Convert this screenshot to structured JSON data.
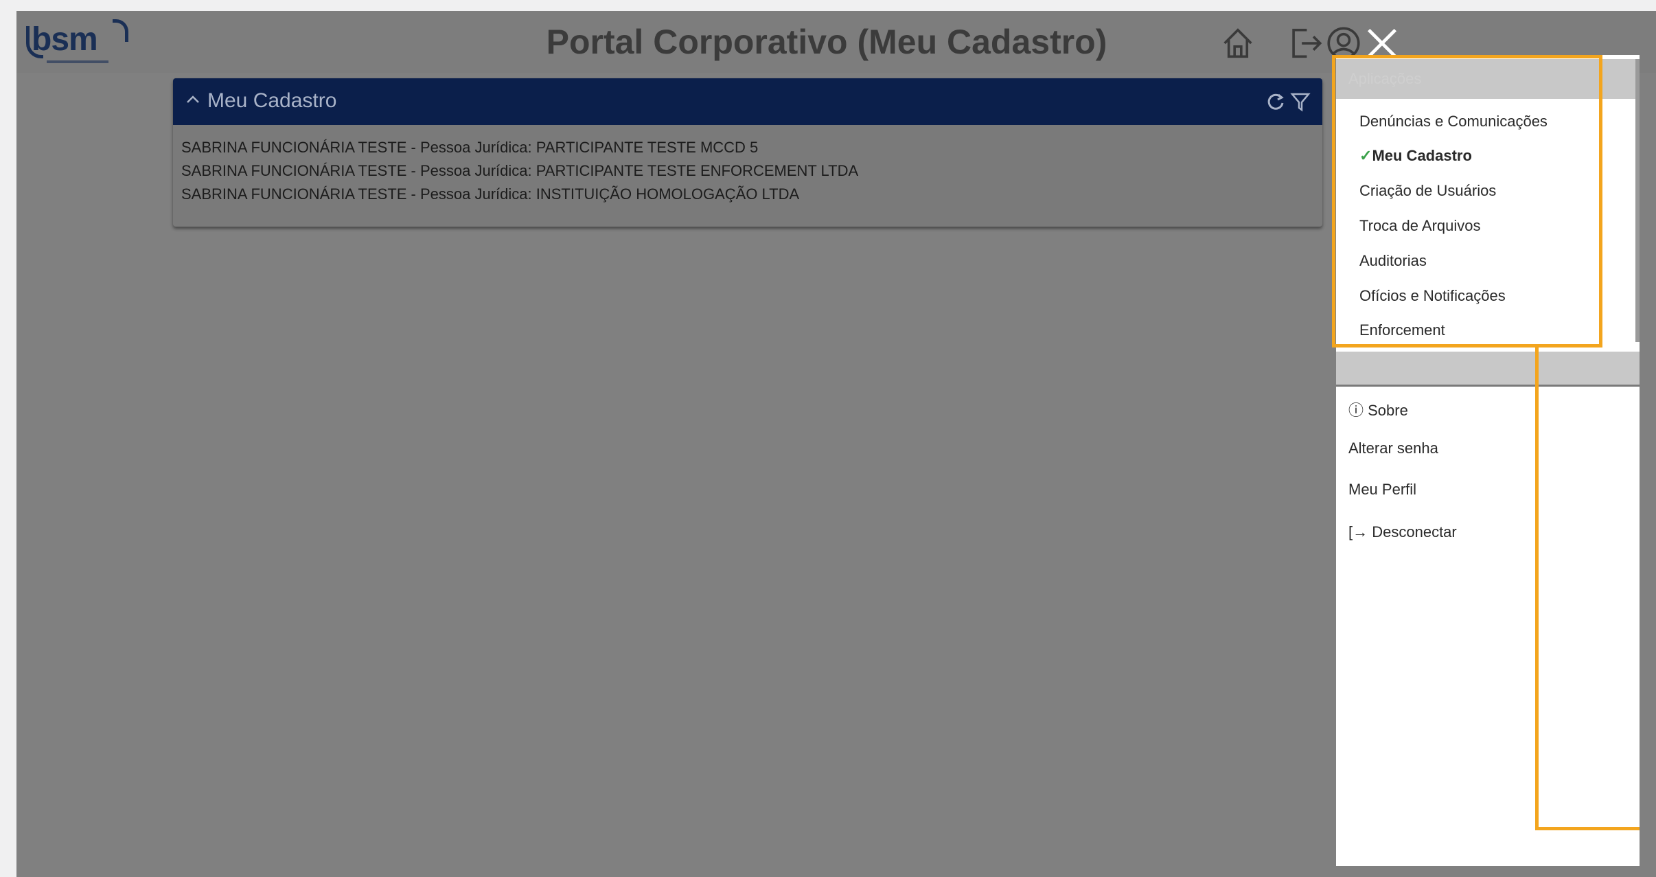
{
  "header": {
    "title": "Portal Corporativo (Meu Cadastro)",
    "logo_text": "bsm",
    "icons": [
      "home-icon",
      "logout-icon",
      "user-circle-icon",
      "close-icon"
    ]
  },
  "card": {
    "title": "Meu Cadastro",
    "rows": [
      "SABRINA FUNCIONÁRIA TESTE - Pessoa Jurídica: PARTICIPANTE TESTE MCCD 5",
      "SABRINA FUNCIONÁRIA TESTE - Pessoa Jurídica: PARTICIPANTE TESTE ENFORCEMENT LTDA",
      "SABRINA FUNCIONÁRIA TESTE - Pessoa Jurídica: INSTITUIÇÃO HOMOLOGAÇÃO LTDA"
    ]
  },
  "apps_menu": {
    "header_label": "Aplicações",
    "items": [
      {
        "label": "Denúncias e Comunicações",
        "active": false
      },
      {
        "label": "Meu Cadastro",
        "active": true
      },
      {
        "label": "Criação de Usuários",
        "active": false
      },
      {
        "label": "Troca de Arquivos",
        "active": false
      },
      {
        "label": "Auditorias",
        "active": false
      },
      {
        "label": "Ofícios e Notificações",
        "active": false
      },
      {
        "label": "Enforcement",
        "active": false
      }
    ]
  },
  "user_menu": {
    "sobre": "Sobre",
    "alterar_senha": "Alterar senha",
    "meu_perfil": "Meu Perfil",
    "desconectar": "Desconectar"
  },
  "colors": {
    "accent": "#f3a51e",
    "card_header": "#0b1f4b",
    "overlay": "#808080",
    "check": "#3aa14a"
  }
}
